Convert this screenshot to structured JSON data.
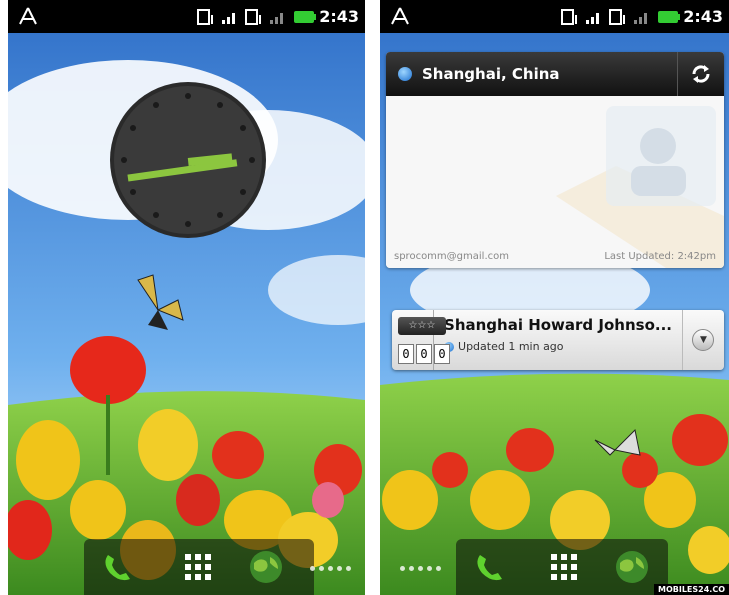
{
  "left_screen": {
    "status": {
      "time": "2:43"
    },
    "clock": {
      "name": "analog-clock"
    },
    "dock": {
      "phone": "phone-icon",
      "apps": "apps-grid-icon",
      "browser": "globe-icon"
    }
  },
  "right_screen": {
    "status": {
      "time": "2:43"
    },
    "location_widget": {
      "place": "Shanghai, China",
      "account": "sprocomm@gmail.com",
      "last_updated": "Last Updated: 2:42pm"
    },
    "checkin_widget": {
      "stars_label": "☆☆☆",
      "count_digits": [
        "0",
        "0",
        "0"
      ],
      "venue": "Shanghai Howard Johnso...",
      "updated": "Updated 1 min ago"
    }
  },
  "watermark": "MOBILES24.CO",
  "colors": {
    "sky": "#3f86d8",
    "grass": "#69b52d",
    "accent_green": "#8cc63f"
  }
}
